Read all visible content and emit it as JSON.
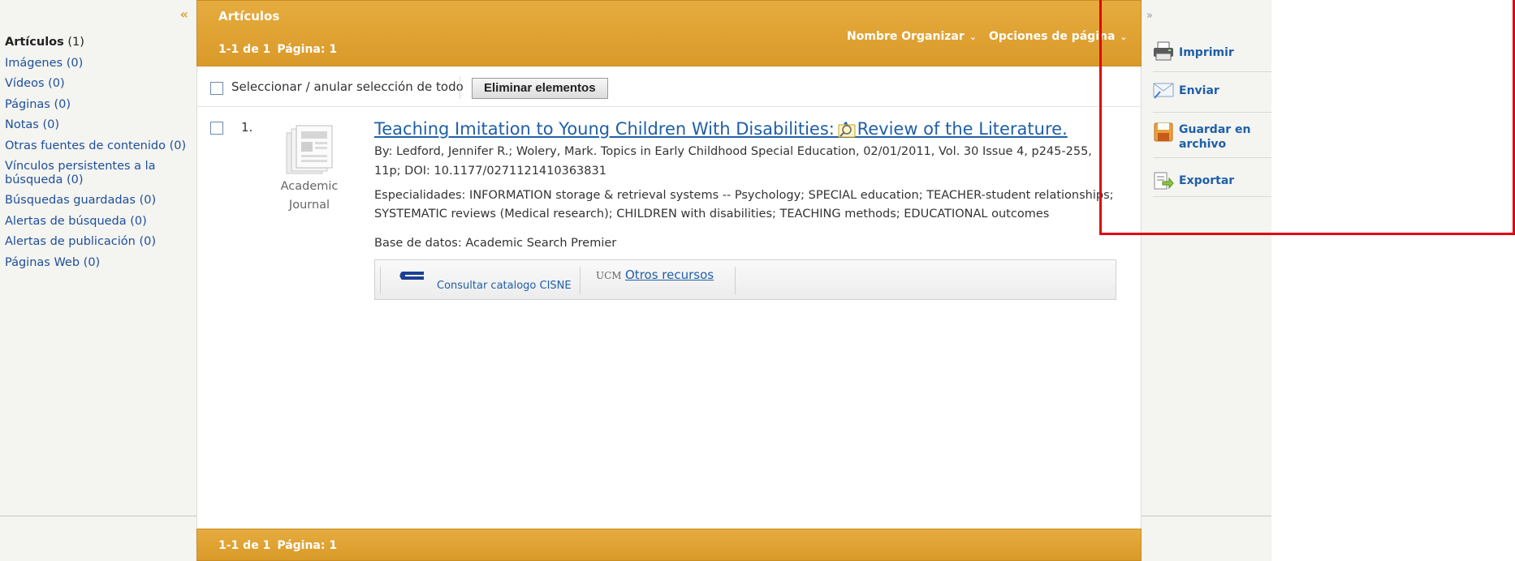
{
  "sidebar": {
    "collapse_label": "«",
    "items": [
      {
        "label": "Artículos",
        "count": "(1)"
      },
      {
        "label": "Imágenes",
        "count": "(0)"
      },
      {
        "label": "Vídeos",
        "count": "(0)"
      },
      {
        "label": "Páginas",
        "count": "(0)"
      },
      {
        "label": "Notas",
        "count": "(0)"
      },
      {
        "label": "Otras fuentes de contenido",
        "count": "(0)"
      },
      {
        "label_line1": "Vínculos persistentes a la",
        "label_line2": "búsqueda",
        "count": "(0)"
      },
      {
        "label": "Búsquedas guardadas",
        "count": "(0)"
      },
      {
        "label": "Alertas de búsqueda",
        "count": "(0)"
      },
      {
        "label": "Alertas de publicación",
        "count": "(0)"
      },
      {
        "label": "Páginas Web",
        "count": "(0)"
      }
    ]
  },
  "main": {
    "title": "Artículos",
    "paging_range": "1-1 de 1",
    "paging_page": "Página: 1",
    "sort_label": "Nombre Organizar",
    "page_options_label": "Opciones de página",
    "chevron": "⌄",
    "select_all_label": "Seleccionar / anular selección de todo",
    "delete_button": "Eliminar elementos"
  },
  "result": {
    "number": "1.",
    "pubtype_line1": "Academic",
    "pubtype_line2": "Journal",
    "title": "Teaching Imitation to Young Children With Disabilities: A Review of the Literature.",
    "meta_line1": "By: Ledford, Jennifer R.; Wolery, Mark. Topics in Early Childhood Special Education, 02/01/2011, Vol. 30 Issue 4, p245-255,",
    "meta_line2": "11p; DOI: 10.1177/0271121410363831",
    "subjects_line1": "Especialidades: INFORMATION storage & retrieval systems -- Psychology; SPECIAL education; TEACHER-student relationships;",
    "subjects_line2": "SYSTEMATIC reviews (Medical research); CHILDREN with disabilities; TEACHING methods; EDUCATIONAL outcomes",
    "database": "Base de datos: Academic Search Premier",
    "link_cisne": "Consultar catalogo CISNE",
    "ucm_logo": "UCM",
    "link_other": "Otros recursos"
  },
  "tools": {
    "expand_label": "»",
    "print": "Imprimir",
    "send": "Enviar",
    "save_line1": "Guardar en",
    "save_line2": "archivo",
    "export": "Exportar"
  },
  "colors": {
    "header_gold": "#dea235",
    "link_blue": "#1f5fa8",
    "highlight_red": "#e3000f"
  },
  "icons": {
    "print": "printer-icon",
    "send": "envelope-icon",
    "save": "floppy-disk-icon",
    "export": "export-icon",
    "preview": "magnifier-preview-icon",
    "journal": "journal-icon"
  }
}
